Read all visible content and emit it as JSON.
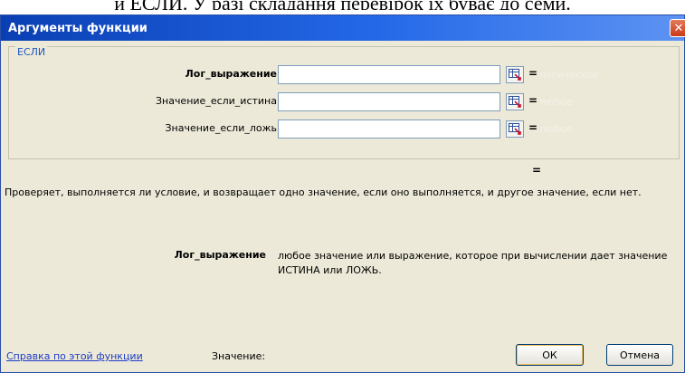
{
  "background_text": "и ЕСЛИ. У разі складання перевірок їх буває до семи.",
  "dialog": {
    "title": "Аргументы функции",
    "close_symbol": "✕",
    "function_name": "ЕСЛИ",
    "args": [
      {
        "label": "Лог_выражение",
        "value": "",
        "result": "логическое",
        "bold": true
      },
      {
        "label": "Значение_если_истина",
        "value": "",
        "result": "любое",
        "bold": false
      },
      {
        "label": "Значение_если_ложь",
        "value": "",
        "result": "любое",
        "bold": false
      }
    ],
    "equals_sign": "=",
    "description": "Проверяет, выполняется ли условие, и возвращает одно значение, если оно выполняется, и другое значение, если нет.",
    "arg_help_name": "Лог_выражение",
    "arg_help_text": "любое значение или выражение, которое при вычислении дает значение ИСТИНА или ЛОЖЬ.",
    "help_link": "Справка по этой функции",
    "value_label": "Значение:",
    "ok_label": "ОК",
    "cancel_label": "Отмена"
  },
  "colors": {
    "title_bar": "#0a3fb3",
    "dialog_bg": "#ece9d8",
    "link": "#1d3cc8",
    "legend": "#1f56c2"
  }
}
